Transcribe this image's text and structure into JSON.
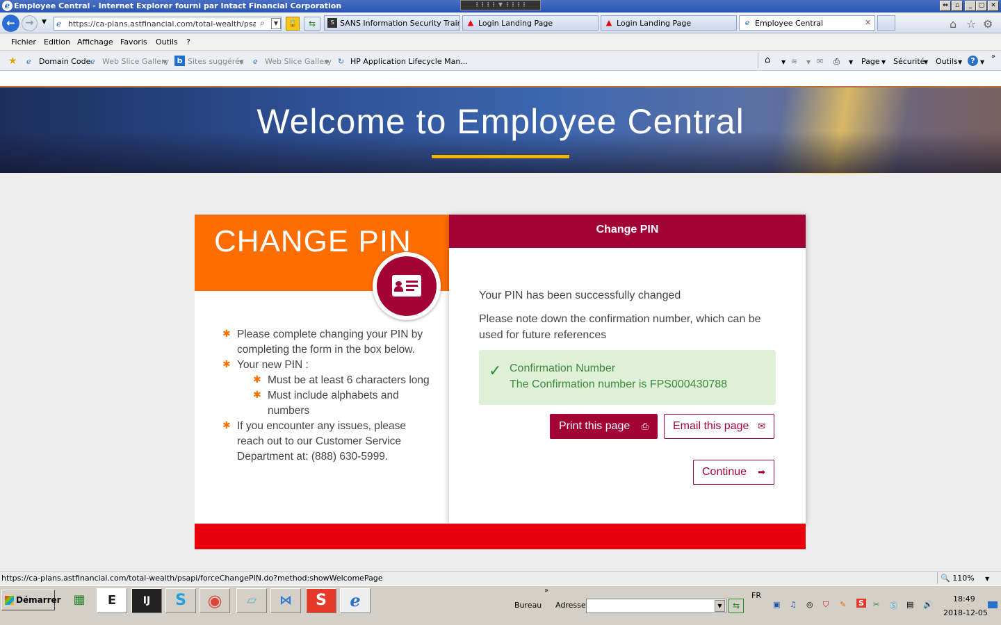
{
  "window": {
    "title": "Employee Central - Internet Explorer fourni par Intact Financial Corporation"
  },
  "address_bar": {
    "url": "https://ca-plans.astfinancial.com/total-wealth/psapi/forc"
  },
  "tabs": [
    {
      "label": "SANS Information Security Train...",
      "icon": "sans-icon"
    },
    {
      "label": "Login Landing Page",
      "icon": "ast-logo-icon"
    },
    {
      "label": "Login Landing Page",
      "icon": "ast-logo-icon"
    },
    {
      "label": "Employee Central",
      "icon": "ie-page-icon",
      "active": true
    }
  ],
  "menu": [
    "Fichier",
    "Edition",
    "Affichage",
    "Favoris",
    "Outils",
    "?"
  ],
  "favorites": {
    "items": [
      "Domain Code",
      "Web Slice Gallery",
      "Sites suggérés",
      "Web Slice Gallery",
      "HP Application Lifecycle Man..."
    ],
    "commands": [
      "Page",
      "Sécurité",
      "Outils"
    ]
  },
  "hero": {
    "title": "Welcome to Employee Central"
  },
  "left_panel": {
    "heading": "CHANGE PIN",
    "instructions": [
      "Please complete changing your PIN by completing the form in the box below.",
      "Your new PIN :",
      "Must be at least 6 characters long",
      "Must include alphabets and numbers",
      "If you encounter any issues, please reach out to our Customer Service Department at: (888) 630-5999."
    ]
  },
  "right_panel": {
    "header": "Change PIN",
    "success_message": "Your PIN has been successfully changed",
    "note": "Please note down the confirmation number, which can be used for future references",
    "confirmation_title": "Confirmation Number",
    "confirmation_text": "The Confirmation number is FPS000430788",
    "print_button": "Print this page",
    "email_button": "Email this page",
    "continue_button": "Continue"
  },
  "colors": {
    "orange": "#ff6c00",
    "maroon": "#a30236",
    "red_bar": "#e8000d",
    "success_bg": "#dff0d8",
    "gold": "#f2b400"
  },
  "status_bar": {
    "url": "https://ca-plans.astfinancial.com/total-wealth/psapi/forceChangePIN.do?method:showWelcomePage",
    "zoom": "110%"
  },
  "taskbar": {
    "start": "Démarrer",
    "bureau": "Bureau",
    "adresse": "Adresse",
    "language": "FR",
    "time": "18:49",
    "date": "2018-12-05"
  }
}
